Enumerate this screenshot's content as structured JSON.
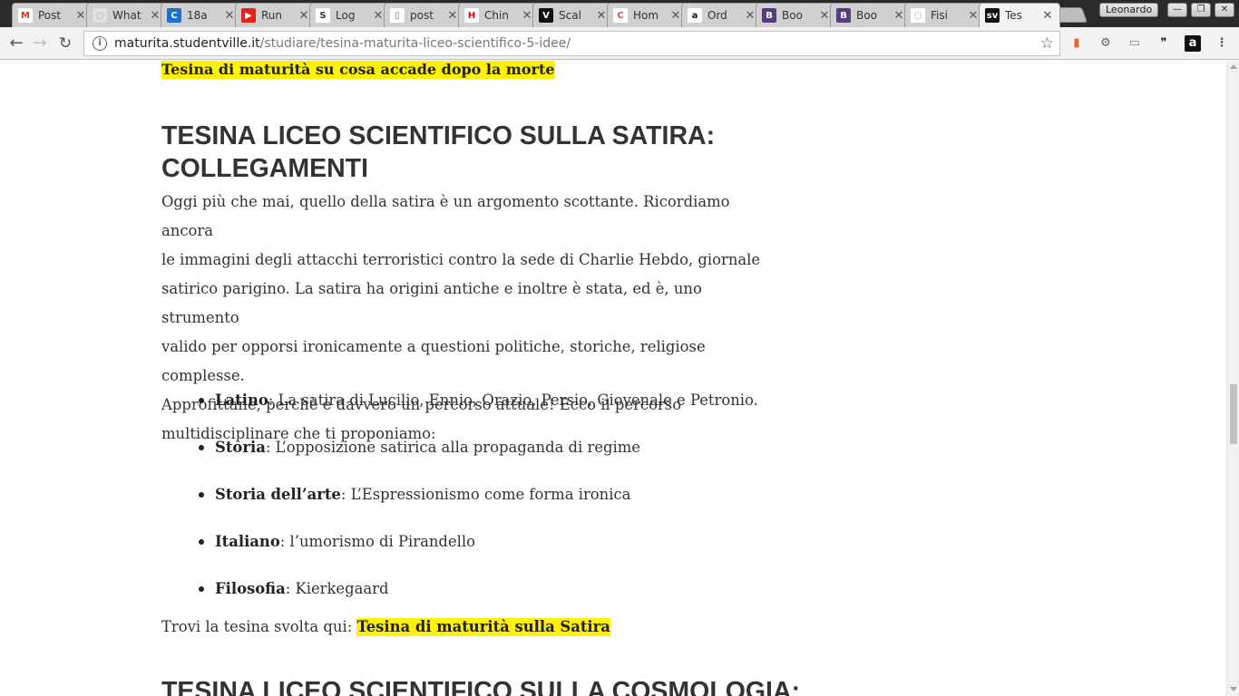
{
  "browser": {
    "tabs": [
      {
        "title": "Post",
        "favicon": "gmail-icon",
        "color": "#ffffff"
      },
      {
        "title": "What",
        "favicon": "loading-icon",
        "color": "#e0e0e0"
      },
      {
        "title": "18a",
        "favicon": "c-icon",
        "color": "#1f6fd0"
      },
      {
        "title": "Run",
        "favicon": "youtube-icon",
        "color": "#e62117"
      },
      {
        "title": "Log",
        "favicon": "s-icon",
        "color": "#ffffff"
      },
      {
        "title": "post",
        "favicon": "page-icon",
        "color": "#ffffff"
      },
      {
        "title": "Chin",
        "favicon": "hm-icon",
        "color": "#ffffff"
      },
      {
        "title": "Scal",
        "favicon": "v-icon",
        "color": "#111111"
      },
      {
        "title": "Hom",
        "favicon": "c-ring-icon",
        "color": "#ffffff"
      },
      {
        "title": "Ord",
        "favicon": "amazon-icon",
        "color": "#ffffff"
      },
      {
        "title": "Boo",
        "favicon": "bootstrap-icon",
        "color": "#563d7c"
      },
      {
        "title": "Boo",
        "favicon": "bootstrap-icon",
        "color": "#563d7c"
      },
      {
        "title": "Fisi",
        "favicon": "loading-icon",
        "color": "#ffffff"
      },
      {
        "title": "Tes",
        "favicon": "sv-icon",
        "color": "#111111",
        "active": true
      }
    ],
    "profile_name": "Leonardo",
    "url_host": "maturita.studentville.it",
    "url_path": "/studiare/tesina-maturita-liceo-scientifico-5-idee/"
  },
  "article": {
    "top_link": "Tesina di maturità  su cosa accade dopo la morte",
    "heading_line1": "TESINA LICEO SCIENTIFICO SULLA SATIRA:",
    "heading_line2": "COLLEGAMENTI",
    "paragraph_lines": [
      "Oggi più che mai, quello della satira è un argomento scottante. Ricordiamo ancora",
      "le immagini degli attacchi terroristici contro la sede di Charlie Hebdo, giornale",
      "satirico parigino. La satira ha origini antiche e inoltre è stata, ed è, uno strumento",
      "valido per opporsi ironicamente a questioni politiche, storiche, religiose complesse.",
      "Approfittane, perchè è davvero un percorso attuale! Ecco il percorso",
      "multidisciplinare che ti proponiamo:"
    ],
    "subjects": [
      {
        "subject": "Latino",
        "text": ": La satira di Lucilio, Ennio, Orazio, Persio, Giovenale e Petronio."
      },
      {
        "subject": "Storia",
        "text": ": L’opposizione satirica alla propaganda di regime"
      },
      {
        "subject": "Storia dell’arte",
        "text": ": L’Espressionismo come forma ironica"
      },
      {
        "subject": "Italiano",
        "text": ": l’umorismo di Pirandello"
      },
      {
        "subject": "Filosofia",
        "text": ": Kierkegaard"
      }
    ],
    "trovi_prefix": "Trovi la tesina svolta qui: ",
    "trovi_link": "Tesina di maturità sulla Satira",
    "next_heading": "TESINA LICEO SCIENTIFICO SULLA COSMOLOGIA:"
  },
  "colors": {
    "highlight": "#fff200",
    "text": "#333333"
  }
}
